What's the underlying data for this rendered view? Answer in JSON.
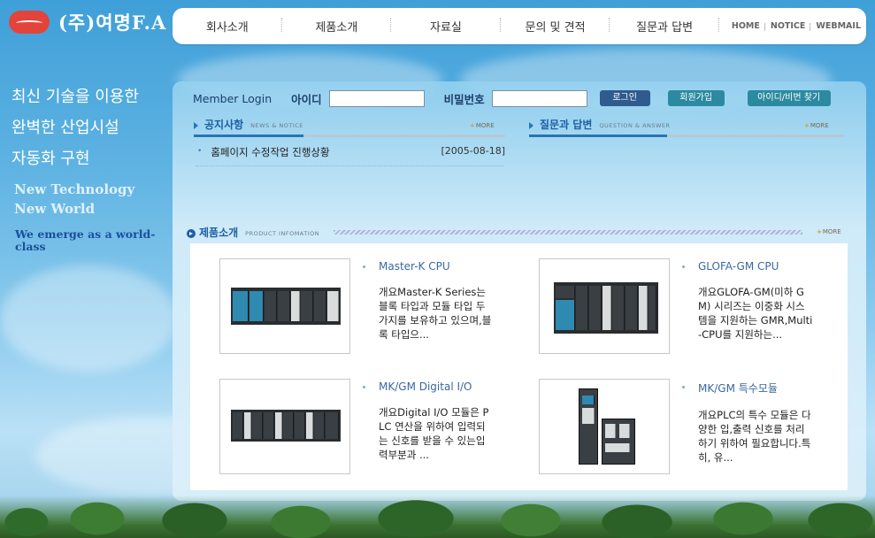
{
  "brand": {
    "name": "(주)여명F.A"
  },
  "nav": {
    "items": [
      "회사소개",
      "제품소개",
      "자료실",
      "문의 및 견적",
      "질문과 답변"
    ],
    "utility": [
      "HOME",
      "NOTICE",
      "WEBMAIL"
    ]
  },
  "slogan": {
    "lines": [
      "최신 기술을 이용한",
      "완벽한 산업시설",
      "자동화 구현"
    ],
    "english_1": "New Technology",
    "english_2": "New World",
    "english_3": "We emerge as a world-class"
  },
  "login": {
    "title": "Member Login",
    "id_label": "아이디",
    "password_label": "비밀번호",
    "login_button": "로그인",
    "join_button": "회원가입",
    "find_button": "아이디/비번 찾기"
  },
  "notice": {
    "title": "공지사항",
    "subtitle": "NEWS & NOTICE",
    "more": "MORE",
    "items": [
      {
        "title": "홈페이지 수정작업 진행상황",
        "date": "[2005-08-18]"
      }
    ]
  },
  "qna": {
    "title": "질문과 답변",
    "subtitle": "QUESTION & ANSWER",
    "more": "MORE"
  },
  "products": {
    "title": "제품소개",
    "subtitle": "PRODUCT INFOMATION",
    "more": "MORE",
    "items": [
      {
        "name": "Master-K CPU",
        "desc": "개요Master-K Series는 블록 타입과 모듈 타입 두가지를 보유하고 있으며,블록 타입으..."
      },
      {
        "name": "GLOFA-GM CPU",
        "desc": "개요GLOFA-GM(미하 GM) 시리즈는 이중화 시스템을 지원하는 GMR,Multi-CPU를 지원하는..."
      },
      {
        "name": "MK/GM Digital I/O",
        "desc": "개요Digital I/O 모듈은 PLC 연산을 위하여 입력되는 신호를 받을 수 있는입력부분과 ..."
      },
      {
        "name": "MK/GM 특수모듈",
        "desc": "개요PLC의 특수 모듈은 다양한 입,출력 신호를 처리하기 위하여 필요합니다.특히, 유..."
      }
    ]
  }
}
